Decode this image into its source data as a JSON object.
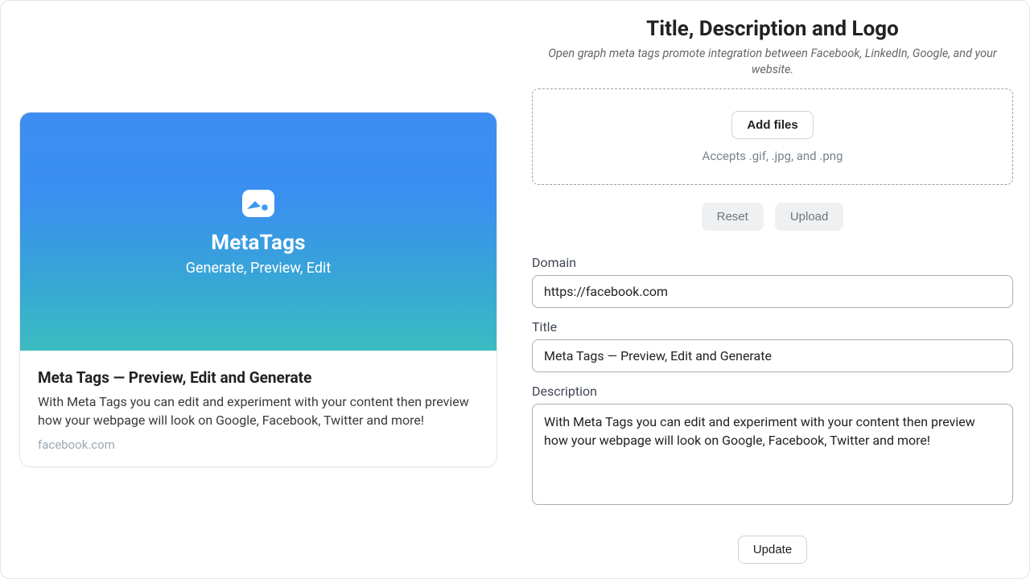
{
  "header": {
    "title": "Title, Description and Logo",
    "subtitle": "Open graph meta tags promote integration between Facebook, LinkedIn, Google, and your website."
  },
  "dropzone": {
    "add_files_label": "Add files",
    "accepts_text": "Accepts .gif, .jpg, and .png"
  },
  "buttons": {
    "reset": "Reset",
    "upload": "Upload",
    "update": "Update"
  },
  "fields": {
    "domain": {
      "label": "Domain",
      "value": "https://facebook.com"
    },
    "title": {
      "label": "Title",
      "value": "Meta Tags — Preview, Edit and Generate"
    },
    "description": {
      "label": "Description",
      "value": "With Meta Tags you can edit and experiment with your content then preview how your webpage will look on Google, Facebook, Twitter and more!"
    }
  },
  "preview": {
    "brand": "MetaTags",
    "tagline": "Generate, Preview, Edit",
    "title": "Meta Tags — Preview, Edit and Generate",
    "description": "With Meta Tags you can edit and experiment with your content then preview how your webpage will look on Google, Facebook, Twitter and more!",
    "domain_display": "facebook.com"
  }
}
